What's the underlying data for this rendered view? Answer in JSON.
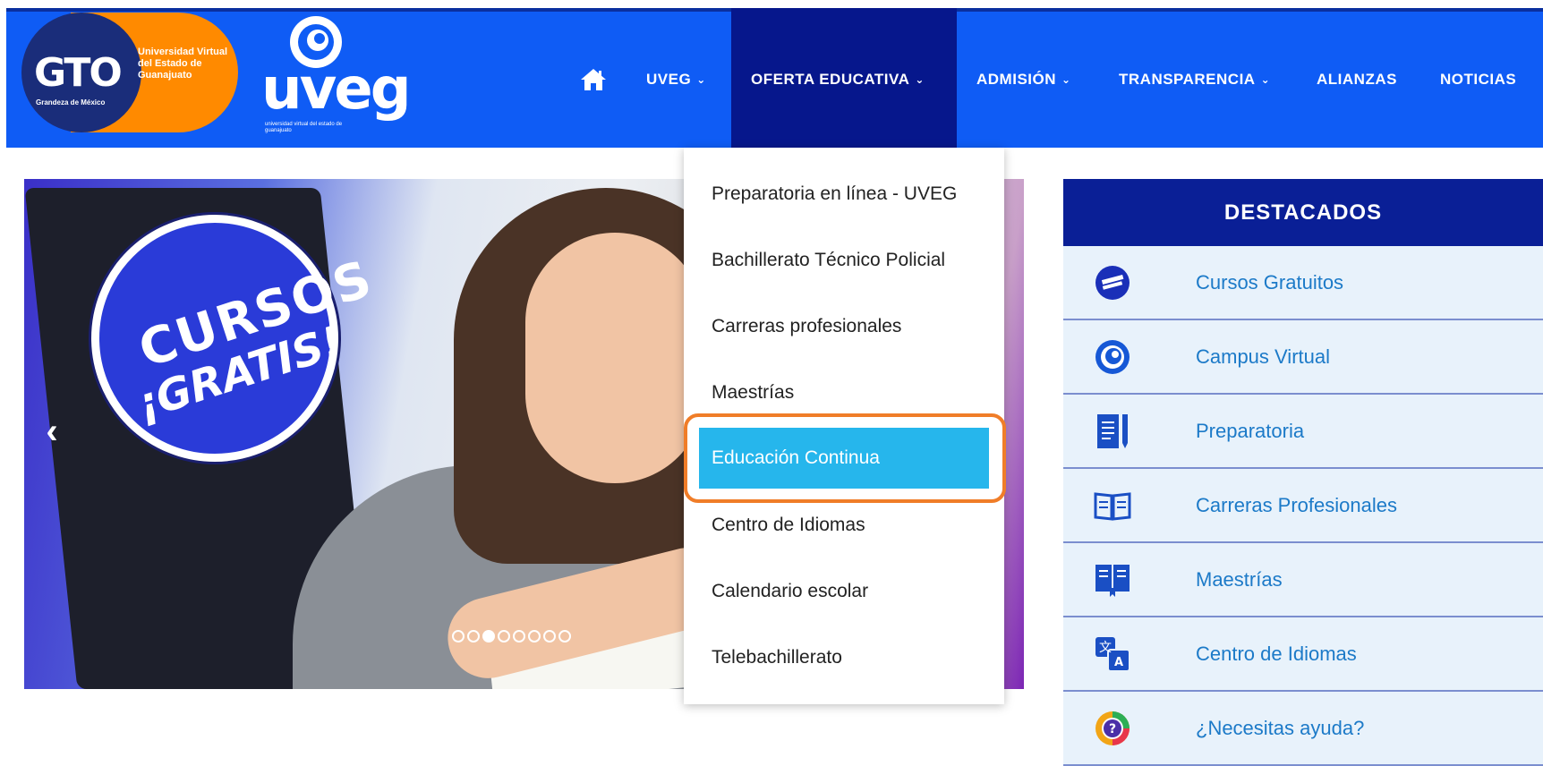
{
  "logos": {
    "gto_word": "GTO",
    "gto_tagline": "Grandeza de México",
    "gto_text": "Universidad Virtual del Estado de Guanajuato",
    "uveg_word": "uveg",
    "uveg_tagline": "universidad virtual del estado de guanajuato"
  },
  "nav": {
    "home_icon": "home-icon",
    "items": [
      {
        "label": "UVEG",
        "has_menu": true
      },
      {
        "label": "OFERTA EDUCATIVA",
        "has_menu": true,
        "active": true
      },
      {
        "label": "ADMISIÓN",
        "has_menu": true
      },
      {
        "label": "TRANSPARENCIA",
        "has_menu": true
      },
      {
        "label": "ALIANZAS",
        "has_menu": false
      },
      {
        "label": "NOTICIAS",
        "has_menu": false
      }
    ],
    "chevron": "⌄"
  },
  "hero": {
    "badge_line1": "CURSOS",
    "badge_line2": "¡GRATIS!",
    "prev_glyph": "‹",
    "slide_count": 8,
    "active_slide": 3
  },
  "dropdown": {
    "items": [
      "Preparatoria en línea - UVEG",
      "Bachillerato Técnico Policial",
      "Carreras profesionales",
      "Maestrías",
      "Educación Continua",
      "Centro de Idiomas",
      "Calendario escolar",
      "Telebachillerato"
    ],
    "highlighted": "Educación Continua"
  },
  "destacados": {
    "title": "DESTACADOS",
    "items": [
      {
        "label": "Cursos Gratuitos",
        "icon": "cursos-badge-icon"
      },
      {
        "label": "Campus Virtual",
        "icon": "uveg-logo-icon"
      },
      {
        "label": "Preparatoria",
        "icon": "document-pen-icon"
      },
      {
        "label": "Carreras Profesionales",
        "icon": "open-book-icon"
      },
      {
        "label": "Maestrías",
        "icon": "certificate-book-icon"
      },
      {
        "label": "Centro de Idiomas",
        "icon": "translate-icon"
      },
      {
        "label": "¿Necesitas ayuda?",
        "icon": "help-icon"
      }
    ]
  },
  "colors": {
    "header_blue": "#0f5cf5",
    "active_nav": "#06178c",
    "highlight": "#26b6ec",
    "outline": "#f07d28",
    "dest_head": "#0a1f96",
    "dest_link": "#1c7ac8"
  }
}
